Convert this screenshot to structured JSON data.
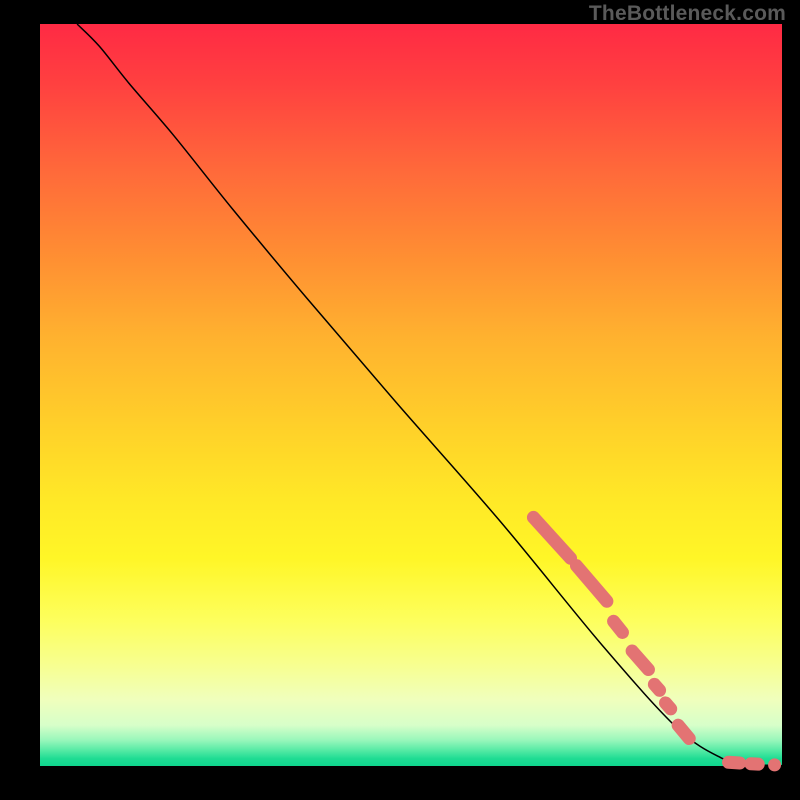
{
  "credit": "TheBottleneck.com",
  "colors": {
    "worm": "#e37373",
    "curve": "#000000"
  },
  "chart_data": {
    "type": "line",
    "title": "",
    "xlabel": "",
    "ylabel": "",
    "xlim": [
      0,
      100
    ],
    "ylim": [
      0,
      100
    ],
    "grid": false,
    "legend": false,
    "series": [
      {
        "name": "curve",
        "x": [
          5,
          8,
          12,
          18,
          26,
          36,
          48,
          62,
          76,
          86,
          92,
          95,
          98,
          100
        ],
        "y": [
          100,
          97,
          92,
          85,
          75,
          63,
          49,
          33,
          16,
          5,
          1,
          0.3,
          0.1,
          0.05
        ]
      }
    ],
    "highlight_segments": [
      {
        "x0": 66.5,
        "y0": 33.5,
        "x1": 71.5,
        "y1": 28.0
      },
      {
        "x0": 72.3,
        "y0": 27.0,
        "x1": 76.4,
        "y1": 22.2
      },
      {
        "x0": 77.3,
        "y0": 19.5,
        "x1": 78.5,
        "y1": 18.0
      },
      {
        "x0": 79.8,
        "y0": 15.5,
        "x1": 82.0,
        "y1": 13.0
      },
      {
        "x0": 82.8,
        "y0": 11.0,
        "x1": 83.5,
        "y1": 10.2
      },
      {
        "x0": 84.3,
        "y0": 8.5,
        "x1": 85.0,
        "y1": 7.7
      },
      {
        "x0": 86.0,
        "y0": 5.5,
        "x1": 87.5,
        "y1": 3.7
      },
      {
        "x0": 92.8,
        "y0": 0.5,
        "x1": 94.3,
        "y1": 0.4
      },
      {
        "x0": 95.8,
        "y0": 0.3,
        "x1": 96.8,
        "y1": 0.25
      }
    ],
    "highlight_points": [
      {
        "x": 99.0,
        "y": 0.15
      }
    ]
  }
}
